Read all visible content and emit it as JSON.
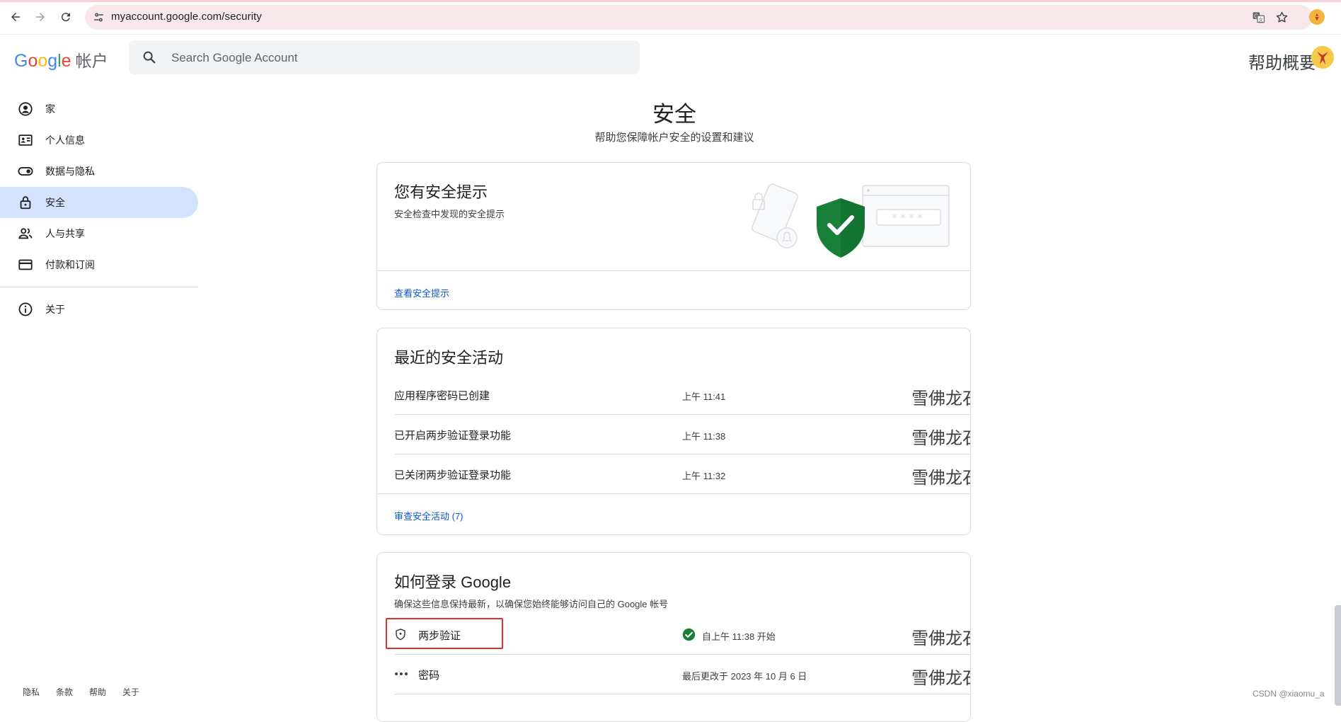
{
  "browser": {
    "url": "myaccount.google.com/security",
    "back_icon": "arrow-back-icon",
    "forward_icon": "arrow-forward-icon",
    "reload_icon": "reload-icon",
    "site_info_icon": "tune-icon",
    "translate_icon": "translate-icon",
    "bookmark_icon": "star-icon",
    "extension_icon": "avatar-extension-icon"
  },
  "header": {
    "logo": [
      "G",
      "o",
      "o",
      "g",
      "l",
      "e"
    ],
    "account_label": "帐户",
    "search_placeholder": "Search Google Account",
    "help_text": "帮助概要"
  },
  "sidebar": {
    "items": [
      {
        "label": "家",
        "icon": "account-circle-icon",
        "active": false
      },
      {
        "label": "个人信息",
        "icon": "badge-icon",
        "active": false
      },
      {
        "label": "数据与隐私",
        "icon": "toggle-icon",
        "active": false
      },
      {
        "label": "安全",
        "icon": "lock-icon",
        "active": true
      },
      {
        "label": "人与共享",
        "icon": "people-icon",
        "active": false
      },
      {
        "label": "付款和订阅",
        "icon": "credit-card-icon",
        "active": false
      }
    ],
    "about": {
      "label": "关于",
      "icon": "info-icon"
    },
    "footer": [
      "隐私",
      "条款",
      "帮助",
      "关于"
    ]
  },
  "main": {
    "title": "安全",
    "subtitle": "帮助您保障帐户安全的设置和建议",
    "security_tips": {
      "title": "您有安全提示",
      "desc": "安全检查中发现的安全提示",
      "link": "查看安全提示",
      "illustration_text": "****"
    },
    "recent_activity": {
      "title": "最近的安全活动",
      "rows": [
        {
          "label": "应用程序密码已创建",
          "time": "上午 11:41",
          "device": "雪佛龙石"
        },
        {
          "label": "已开启两步验证登录功能",
          "time": "上午 11:38",
          "device": "雪佛龙石"
        },
        {
          "label": "已关闭两步验证登录功能",
          "time": "上午 11:32",
          "device": "雪佛龙石"
        }
      ],
      "link": "审查安全活动 (7)"
    },
    "signin": {
      "title": "如何登录 Google",
      "desc": "确保这些信息保持最新，以确保您始终能够访问自己的 Google 帐号",
      "rows": [
        {
          "label": "两步验证",
          "status": "自上午 11:38 开始",
          "icon": "shield-icon",
          "status_icon": "check-circle-icon",
          "device": "雪佛龙石"
        },
        {
          "label": "密码",
          "status": "最后更改于 2023 年 10 月 6 日",
          "icon": "password-dots-icon",
          "device": "雪佛龙石"
        }
      ]
    }
  },
  "watermark": "CSDN @xiaomu_a",
  "colors": {
    "accent": "#0b57d0",
    "active_nav": "#d3e3fd",
    "shield_green": "#188038",
    "highlight_red": "#e0312c"
  }
}
